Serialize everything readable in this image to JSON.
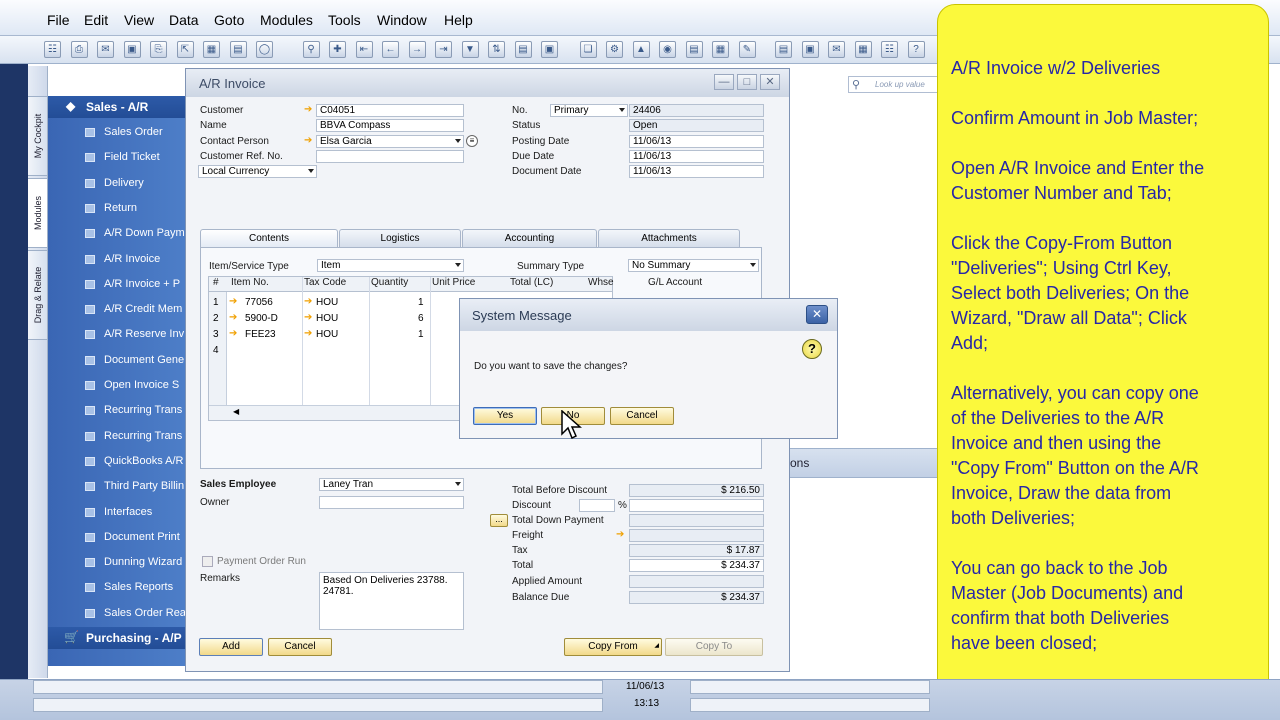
{
  "menu": [
    "File",
    "Edit",
    "View",
    "Data",
    "Goto",
    "Modules",
    "Tools",
    "Window",
    "Help"
  ],
  "toolbar_icons": [
    "preview-icon",
    "print-icon",
    "email-icon",
    "sms-icon",
    "fax-icon",
    "export-icon",
    "excel-icon",
    "word-icon",
    "lock-icon",
    "find-icon",
    "add-icon",
    "first-record-icon",
    "previous-record-icon",
    "next-record-icon",
    "last-record-icon",
    "filter-icon",
    "sort-icon",
    "base-document-icon",
    "target-document-icon",
    "copy-icon",
    "settings-icon",
    "gross-profit-icon",
    "payment-icon",
    "book-icon",
    "calendar-icon",
    "edit-icon",
    "documents-icon",
    "drafts-icon",
    "message-icon",
    "calculator-icon",
    "organization-icon",
    "help-icon"
  ],
  "side_tabs": {
    "cockpit": "My Cockpit",
    "modules": "Modules",
    "drag_relate": "Drag & Relate"
  },
  "nav": {
    "sales_header": "Sales - A/R",
    "items": [
      "Sales Order",
      "Field Ticket",
      "Delivery",
      "Return",
      "A/R Down Paym",
      "A/R Invoice",
      "A/R Invoice + P",
      "A/R Credit Mem",
      "A/R Reserve Inv",
      "Document Gene",
      "Open Invoice S",
      "Recurring Trans",
      "Recurring Trans",
      "QuickBooks A/R",
      "Third Party Billin",
      "Interfaces",
      "Document Print",
      "Dunning Wizard",
      "Sales Reports",
      "Sales Order Rea"
    ],
    "purchasing_header": "Purchasing - A/P"
  },
  "invoice": {
    "title": "A/R Invoice",
    "labels": {
      "customer": "Customer",
      "name": "Name",
      "contact": "Contact Person",
      "custref": "Customer Ref. No.",
      "no": "No.",
      "status": "Status",
      "posting": "Posting Date",
      "due": "Due Date",
      "docdate": "Document Date"
    },
    "customer": "C04051",
    "name": "BBVA Compass",
    "contact": "Elsa Garcia",
    "custref": "",
    "currency": "Local Currency",
    "series": "Primary",
    "number": "24406",
    "status": "Open",
    "posting_date": "11/06/13",
    "due_date": "11/06/13",
    "document_date": "11/06/13",
    "tabs": [
      "Contents",
      "Logistics",
      "Accounting",
      "Attachments"
    ],
    "item_service_type_label": "Item/Service Type",
    "item_service_type": "Item",
    "summary_type_label": "Summary Type",
    "summary_type": "No Summary",
    "columns": [
      "#",
      "Item No.",
      "Tax Code",
      "Quantity",
      "Unit Price",
      "Total (LC)",
      "Whse",
      "G/L Account"
    ],
    "rows": [
      {
        "n": "1",
        "item": "77056",
        "tax": "HOU",
        "qty": "1"
      },
      {
        "n": "2",
        "item": "5900-D",
        "tax": "HOU",
        "qty": "6"
      },
      {
        "n": "3",
        "item": "FEE23",
        "tax": "HOU",
        "qty": "1"
      },
      {
        "n": "4",
        "item": "",
        "tax": "",
        "qty": ""
      }
    ],
    "sales_employee_label": "Sales Employee",
    "sales_employee": "Laney Tran",
    "owner_label": "Owner",
    "payment_order_run": "Payment Order Run",
    "remarks_label": "Remarks",
    "remarks": "Based On Deliveries 23788. 24781.",
    "totals_labels": {
      "before": "Total Before Discount",
      "discount": "Discount",
      "pct": "%",
      "down": "Total Down Payment",
      "freight": "Freight",
      "tax": "Tax",
      "total": "Total",
      "applied": "Applied Amount",
      "balance": "Balance Due"
    },
    "total_before_discount": "$ 216.50",
    "tax": "$ 17.87",
    "total": "$ 234.37",
    "balance_due": "$ 234.37",
    "btn_add": "Add",
    "btn_cancel": "Cancel",
    "btn_copy_from": "Copy From",
    "btn_copy_to": "Copy To",
    "btn_ellipsis": "..."
  },
  "dialog": {
    "title": "System Message",
    "message": "Do you want to save the changes?",
    "yes": "Yes",
    "no": "No",
    "cancel": "Cancel"
  },
  "background": {
    "search_placeholder": "Look up value",
    "stripe_text": "ons"
  },
  "note": [
    "A/R Invoice w/2 Deliveries",
    "Confirm Amount in Job Master;",
    "Open A/R Invoice and Enter the",
    "Customer Number and Tab;",
    "Click the Copy-From Button",
    "\"Deliveries\"; Using Ctrl Key,",
    "Select both Deliveries; On the",
    "Wizard, \"Draw all Data\"; Click",
    "Add;",
    "Alternatively, you can copy one",
    "of the Deliveries to the A/R",
    "Invoice and then using the",
    "\"Copy From\" Button on the A/R",
    "Invoice, Draw the data from",
    "both Deliveries;",
    "You can go back to the Job",
    "Master (Job Documents) and",
    "confirm that both Deliveries",
    "have been closed;"
  ],
  "status": {
    "date": "11/06/13",
    "time": "13:13"
  },
  "colors": {
    "note_bg": "#fbf93c",
    "note_text": "#2727a8",
    "nav_bg": "#4d7ec8",
    "button": "#f2d98a"
  }
}
